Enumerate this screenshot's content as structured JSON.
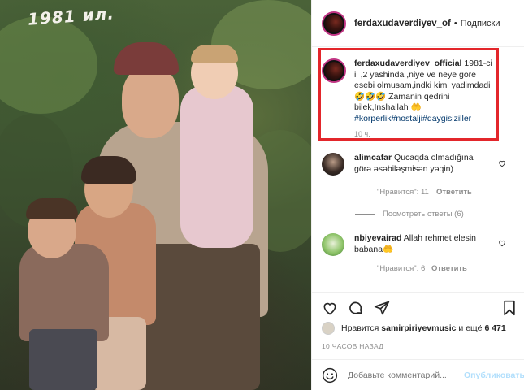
{
  "photo": {
    "year_overlay": "1981 ил."
  },
  "header": {
    "username": "ferdaxudaverdiyev_of",
    "separator": "•",
    "follow_label": "Подписки"
  },
  "caption": {
    "username": "ferdaxudaverdiyev_official",
    "text": "1981-ci il ,2 yashinda ,niye ve neye gore esebi olmusam,indki kimi yadimdadi🤣🤣🤣 Zamanin qedrini bilek,Inshallah 🤲",
    "hashtags": "#korperlik#nostalji#qaygisiziller",
    "time": "10 ч."
  },
  "comments": [
    {
      "username": "alimcafar",
      "text": "Qucaqda olmadığına görə əsəbiləşmisən yəqin)",
      "likes_label": "\"Нравится\": 11",
      "reply_label": "Ответить",
      "view_replies": "Посмотреть ответы (6)"
    },
    {
      "username": "nbiyevairad",
      "text": "Allah rehmet elesin babana🤲",
      "likes_label": "\"Нравится\": 6",
      "reply_label": "Ответить"
    }
  ],
  "likes": {
    "prefix": "Нравится",
    "user": "samirpiriyevmusic",
    "suffix": "и ещё",
    "count": "6 471"
  },
  "posted": "10 ЧАСОВ НАЗАД",
  "add_comment": {
    "placeholder": "Добавьте комментарий...",
    "publish_label": "Опубликовать"
  },
  "colors": {
    "highlight_border": "#e3262b",
    "link_blue": "#00376b",
    "publish_disabled": "#b2dffc",
    "muted": "#8e8e8e"
  }
}
